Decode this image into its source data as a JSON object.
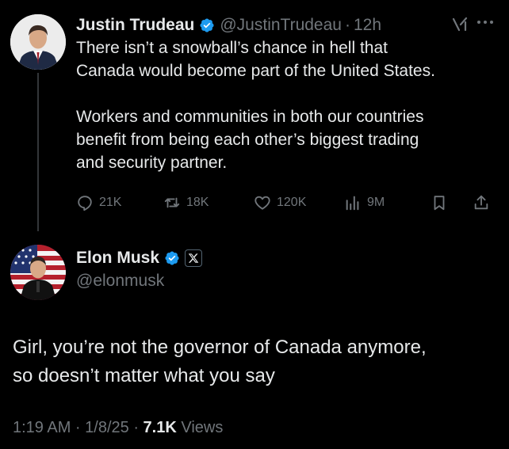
{
  "tweet": {
    "author_name": "Justin Trudeau",
    "handle": "@JustinTrudeau",
    "separator": "·",
    "time": "12h",
    "text_line1": "There isn’t a snowball’s chance in hell that",
    "text_line2": "Canada would become part of the United States.",
    "text_line3": "Workers and communities in both our countries",
    "text_line4": "benefit from being each other’s biggest trading",
    "text_line5": "and security partner.",
    "stats": {
      "replies": "21K",
      "reposts": "18K",
      "likes": "120K",
      "views": "9M"
    },
    "icons": [
      "verified-badge-icon",
      "grok-icon",
      "more-icon",
      "reply-icon",
      "repost-icon",
      "like-icon",
      "views-icon",
      "bookmark-icon",
      "share-icon"
    ]
  },
  "reply": {
    "author_name": "Elon Musk",
    "handle": "@elonmusk",
    "text_line1": "Girl, you’re not the governor of Canada anymore,",
    "text_line2": "so doesn’t matter what you say",
    "timestamp": "1:19 AM · 1/8/25 · ",
    "views_count": "7.1K",
    "views_label": " Views",
    "icons": [
      "verified-badge-icon",
      "x-affiliation-icon"
    ]
  },
  "colors": {
    "background": "#000000",
    "text_primary": "#e7e9ea",
    "text_secondary": "#71767b",
    "verified_blue": "#1d9bf0",
    "thread_line": "#333639"
  }
}
